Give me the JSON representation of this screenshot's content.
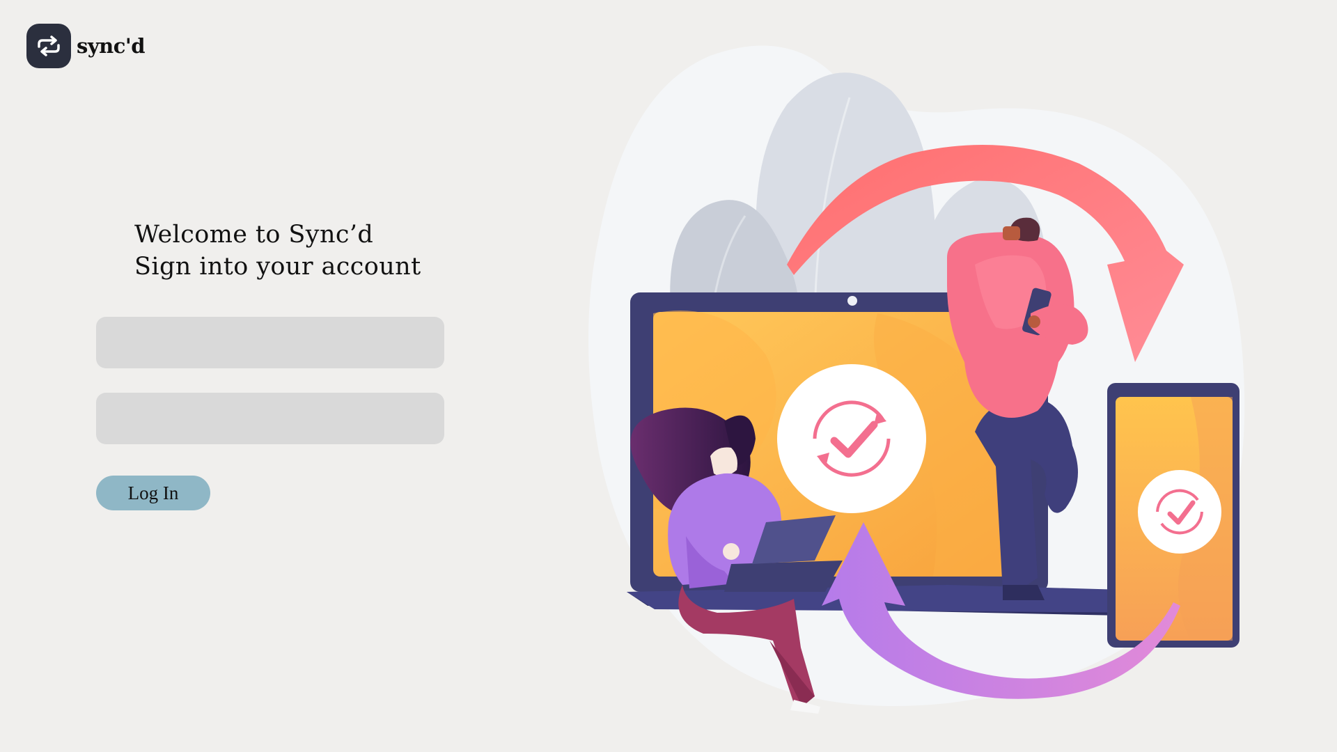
{
  "brand": {
    "name": "sync'd",
    "logo_icon": "sync-arrows-icon"
  },
  "login": {
    "welcome_line": "Welcome to Sync’d",
    "subtitle_line": "Sign into your account",
    "username_placeholder": "",
    "password_placeholder": "",
    "login_label": "Log In"
  },
  "colors": {
    "background": "#f0efed",
    "field_background": "#d9d9d9",
    "button_background": "#8fb7c6",
    "logo_badge": "#2b2f3e"
  },
  "illustration": {
    "icons": [
      "laptop-icon",
      "tablet-icon",
      "sync-check-icon",
      "person-with-phone",
      "person-with-laptop"
    ]
  }
}
